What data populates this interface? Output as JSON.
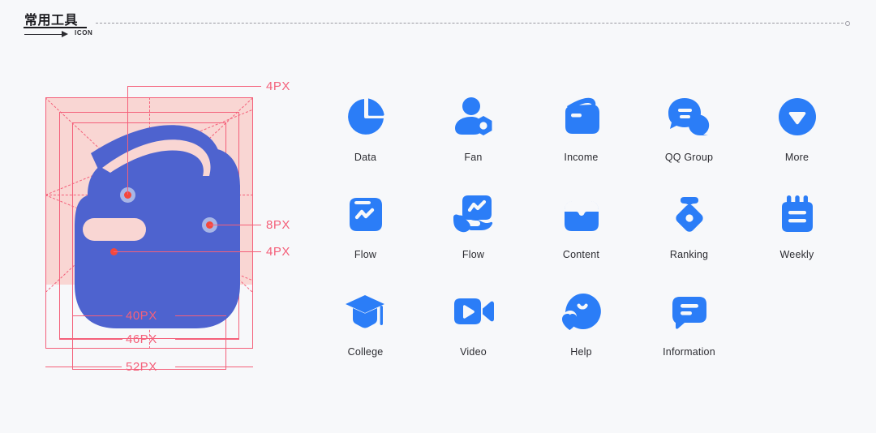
{
  "page": {
    "background_color": "#f7f8fa",
    "accent_blue": "#2b7df7",
    "spec_icon_color": "#4e63cf",
    "spec_guide_color": "#f4607a",
    "spec_guide_fill": "#f9d6d3",
    "spec_dot_color": "#f4483c",
    "label_color": "#2b2b30"
  },
  "header": {
    "title": "常用工具",
    "arrow_icon": "arrow-right-icon",
    "annotation": "ICON",
    "end_marker": "circle-marker"
  },
  "spec": {
    "icon_name": "income-bag-icon",
    "radius_callouts": [
      {
        "id": "r-top",
        "value": "4PX"
      },
      {
        "id": "r-right",
        "value": "8PX"
      },
      {
        "id": "r-slot",
        "value": "4PX"
      }
    ],
    "size_callouts": [
      {
        "id": "inner",
        "value": "40PX"
      },
      {
        "id": "middle",
        "value": "46PX"
      },
      {
        "id": "outer",
        "value": "52PX"
      }
    ]
  },
  "grid": {
    "rows": [
      [
        {
          "icon": "pie-chart-icon",
          "label": "Data"
        },
        {
          "icon": "fan-person-gear-icon",
          "label": "Fan"
        },
        {
          "icon": "income-wallet-icon",
          "label": "Income"
        },
        {
          "icon": "qq-group-chat-icon",
          "label": "QQ Group"
        },
        {
          "icon": "more-chevron-circle-icon",
          "label": "More"
        }
      ],
      [
        {
          "icon": "flow-bag-chart-icon",
          "label": "Flow"
        },
        {
          "icon": "flow-hand-chart-icon",
          "label": "Flow"
        },
        {
          "icon": "content-inbox-icon",
          "label": "Content"
        },
        {
          "icon": "ranking-medal-icon",
          "label": "Ranking"
        },
        {
          "icon": "weekly-notepad-icon",
          "label": "Weekly"
        }
      ],
      [
        {
          "icon": "college-cap-icon",
          "label": "College"
        },
        {
          "icon": "video-camera-icon",
          "label": "Video"
        },
        {
          "icon": "help-smiley-heart-icon",
          "label": "Help"
        },
        {
          "icon": "information-bubble-icon",
          "label": "Information"
        },
        {
          "icon": "",
          "label": ""
        }
      ]
    ]
  }
}
